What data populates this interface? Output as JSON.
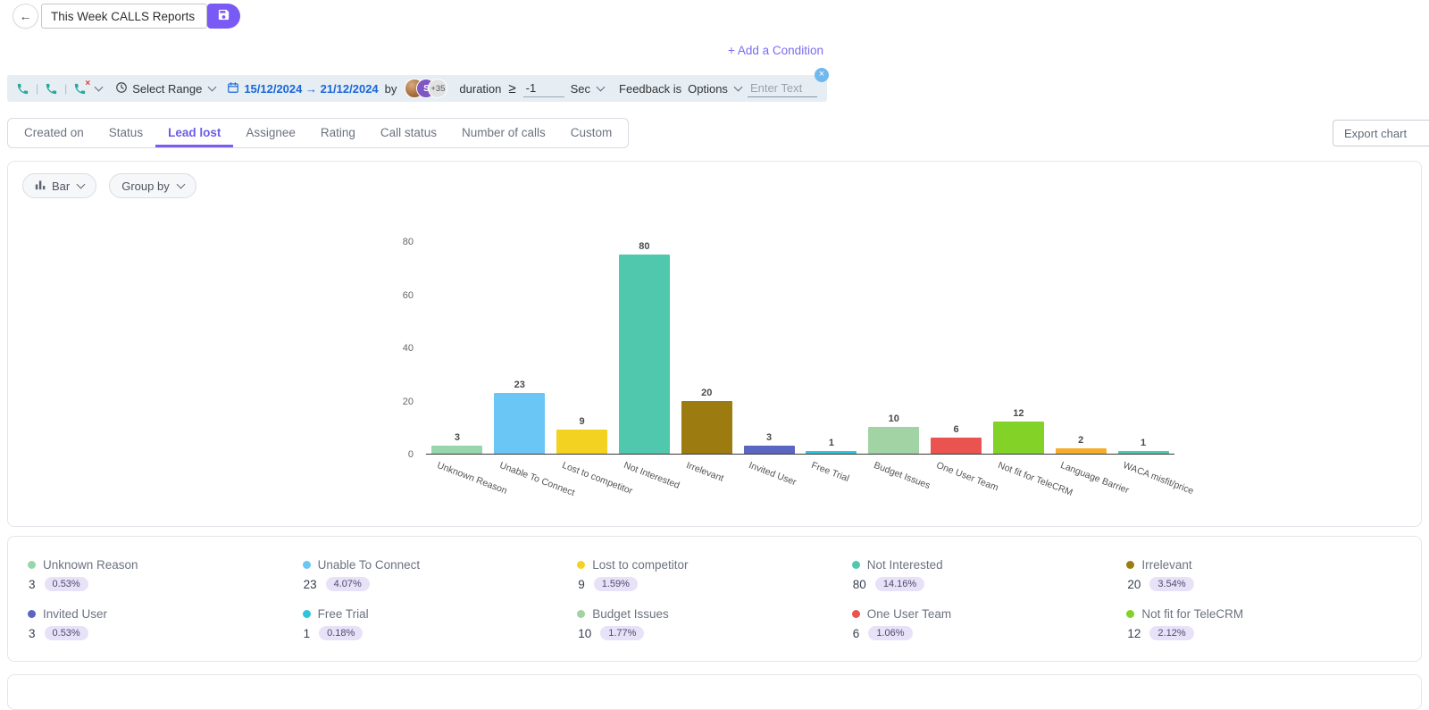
{
  "icons": {
    "back": "←",
    "close": "×"
  },
  "header": {
    "title_value": "This Week CALLS Reports"
  },
  "conditions": {
    "add_condition_label": "+ Add a Condition"
  },
  "filter_bar": {
    "separator": "|",
    "select_range_label": "Select Range",
    "date_range_text": "15/12/2024 → 21/12/2024",
    "by_label": "by",
    "avatar_initial": "S",
    "avatar_more": "+35",
    "duration_label": "duration",
    "comparator": "≥",
    "duration_value": "-1",
    "unit_label": "Sec",
    "feedback_label": "Feedback is",
    "options_label": "Options",
    "enter_text_placeholder": "Enter Text"
  },
  "tabs": {
    "items": [
      "Created on",
      "Status",
      "Lead lost",
      "Assignee",
      "Rating",
      "Call status",
      "Number of calls",
      "Custom"
    ],
    "active": "Lead lost",
    "export_label": "Export chart"
  },
  "chart_controls": {
    "type_label": "Bar",
    "group_by_label": "Group by"
  },
  "chart_data": {
    "type": "bar",
    "title": "",
    "xlabel": "",
    "ylabel": "",
    "categories": [
      "Unknown Reason",
      "Unable To Connect",
      "Lost to competitor",
      "Not Interested",
      "Irrelevant",
      "Invited User",
      "Free Trial",
      "Budget Issues",
      "One User Team",
      "Not fit for TeleCRM",
      "Language Barrier",
      "WACA misfit/price"
    ],
    "values": [
      3,
      23,
      9,
      80,
      20,
      3,
      1,
      10,
      6,
      12,
      2,
      1
    ],
    "colors": [
      "#97d6ad",
      "#6ac6f5",
      "#f4d222",
      "#50c8ae",
      "#9c7c10",
      "#5a66c2",
      "#2cc5da",
      "#a2d3a4",
      "#eb5351",
      "#83d228",
      "#f6ad2b",
      "#50c8ae"
    ],
    "ylim": [
      0,
      80
    ],
    "yticks": [
      0,
      20,
      40,
      60,
      80
    ],
    "grid": false,
    "legend_position": "bottom"
  },
  "legend": {
    "items": [
      {
        "label": "Unknown Reason",
        "value": "3",
        "percent": "0.53%",
        "color": "#97d6ad"
      },
      {
        "label": "Unable To Connect",
        "value": "23",
        "percent": "4.07%",
        "color": "#6ac6f5"
      },
      {
        "label": "Lost to competitor",
        "value": "9",
        "percent": "1.59%",
        "color": "#f4d222"
      },
      {
        "label": "Not Interested",
        "value": "80",
        "percent": "14.16%",
        "color": "#50c8ae"
      },
      {
        "label": "Irrelevant",
        "value": "20",
        "percent": "3.54%",
        "color": "#9c7c10"
      },
      {
        "label": "Invited User",
        "value": "3",
        "percent": "0.53%",
        "color": "#5a66c2"
      },
      {
        "label": "Free Trial",
        "value": "1",
        "percent": "0.18%",
        "color": "#2cc5da"
      },
      {
        "label": "Budget Issues",
        "value": "10",
        "percent": "1.77%",
        "color": "#a2d3a4"
      },
      {
        "label": "One User Team",
        "value": "6",
        "percent": "1.06%",
        "color": "#eb5351"
      },
      {
        "label": "Not fit for TeleCRM",
        "value": "12",
        "percent": "2.12%",
        "color": "#83d228"
      }
    ]
  }
}
